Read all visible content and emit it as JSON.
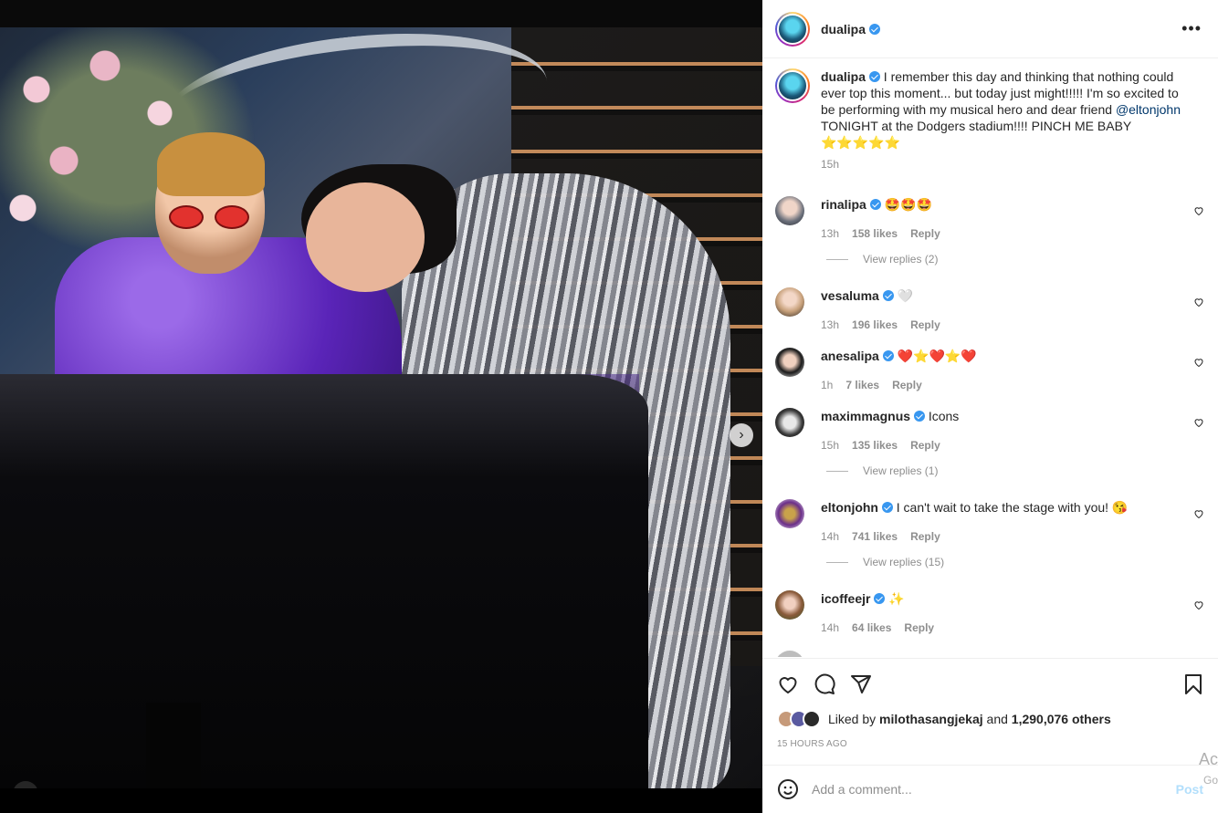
{
  "post": {
    "username": "dualipa",
    "more_label": "•••",
    "carousel_next": "›",
    "caption": {
      "text_before": " I remember this day and thinking that nothing could ever top this moment... but today just might!!!!! I'm so excited to be performing with my musical hero and dear friend ",
      "mention": "@eltonjohn",
      "text_after": " TONIGHT at the Dodgers stadium!!!! PINCH ME BABY ⭐⭐⭐⭐⭐",
      "time": "15h"
    }
  },
  "comments": [
    {
      "user": "rinalipa",
      "text": "🤩🤩🤩",
      "time": "13h",
      "likes": "158 likes",
      "reply": "Reply",
      "view_replies": "View replies (2)"
    },
    {
      "user": "vesaluma",
      "text": "🤍",
      "time": "13h",
      "likes": "196 likes",
      "reply": "Reply"
    },
    {
      "user": "anesalipa",
      "text": "❤️⭐❤️⭐❤️",
      "time": "1h",
      "likes": "7 likes",
      "reply": "Reply"
    },
    {
      "user": "maximmagnus",
      "text": "Icons",
      "time": "15h",
      "likes": "135 likes",
      "reply": "Reply",
      "view_replies": "View replies (1)"
    },
    {
      "user": "eltonjohn",
      "text": "I can't wait to take the stage with you! 😘",
      "time": "14h",
      "likes": "741 likes",
      "reply": "Reply",
      "view_replies": "View replies (15)"
    },
    {
      "user": "icoffeejr",
      "text": "✨",
      "time": "14h",
      "likes": "64 likes",
      "reply": "Reply"
    }
  ],
  "likes_bar": {
    "prefix": "Liked by ",
    "user": "milothasangjekaj",
    "and": " and ",
    "others": "1,290,076 others",
    "time_ago": "15 HOURS AGO"
  },
  "add_comment": {
    "placeholder": "Add a comment...",
    "post_label": "Post"
  },
  "watermark": {
    "line1": "Ac",
    "line2": "Go"
  },
  "colors": {
    "verified": "#3897f0",
    "link": "#00376b",
    "muted": "#8e8e8e"
  }
}
